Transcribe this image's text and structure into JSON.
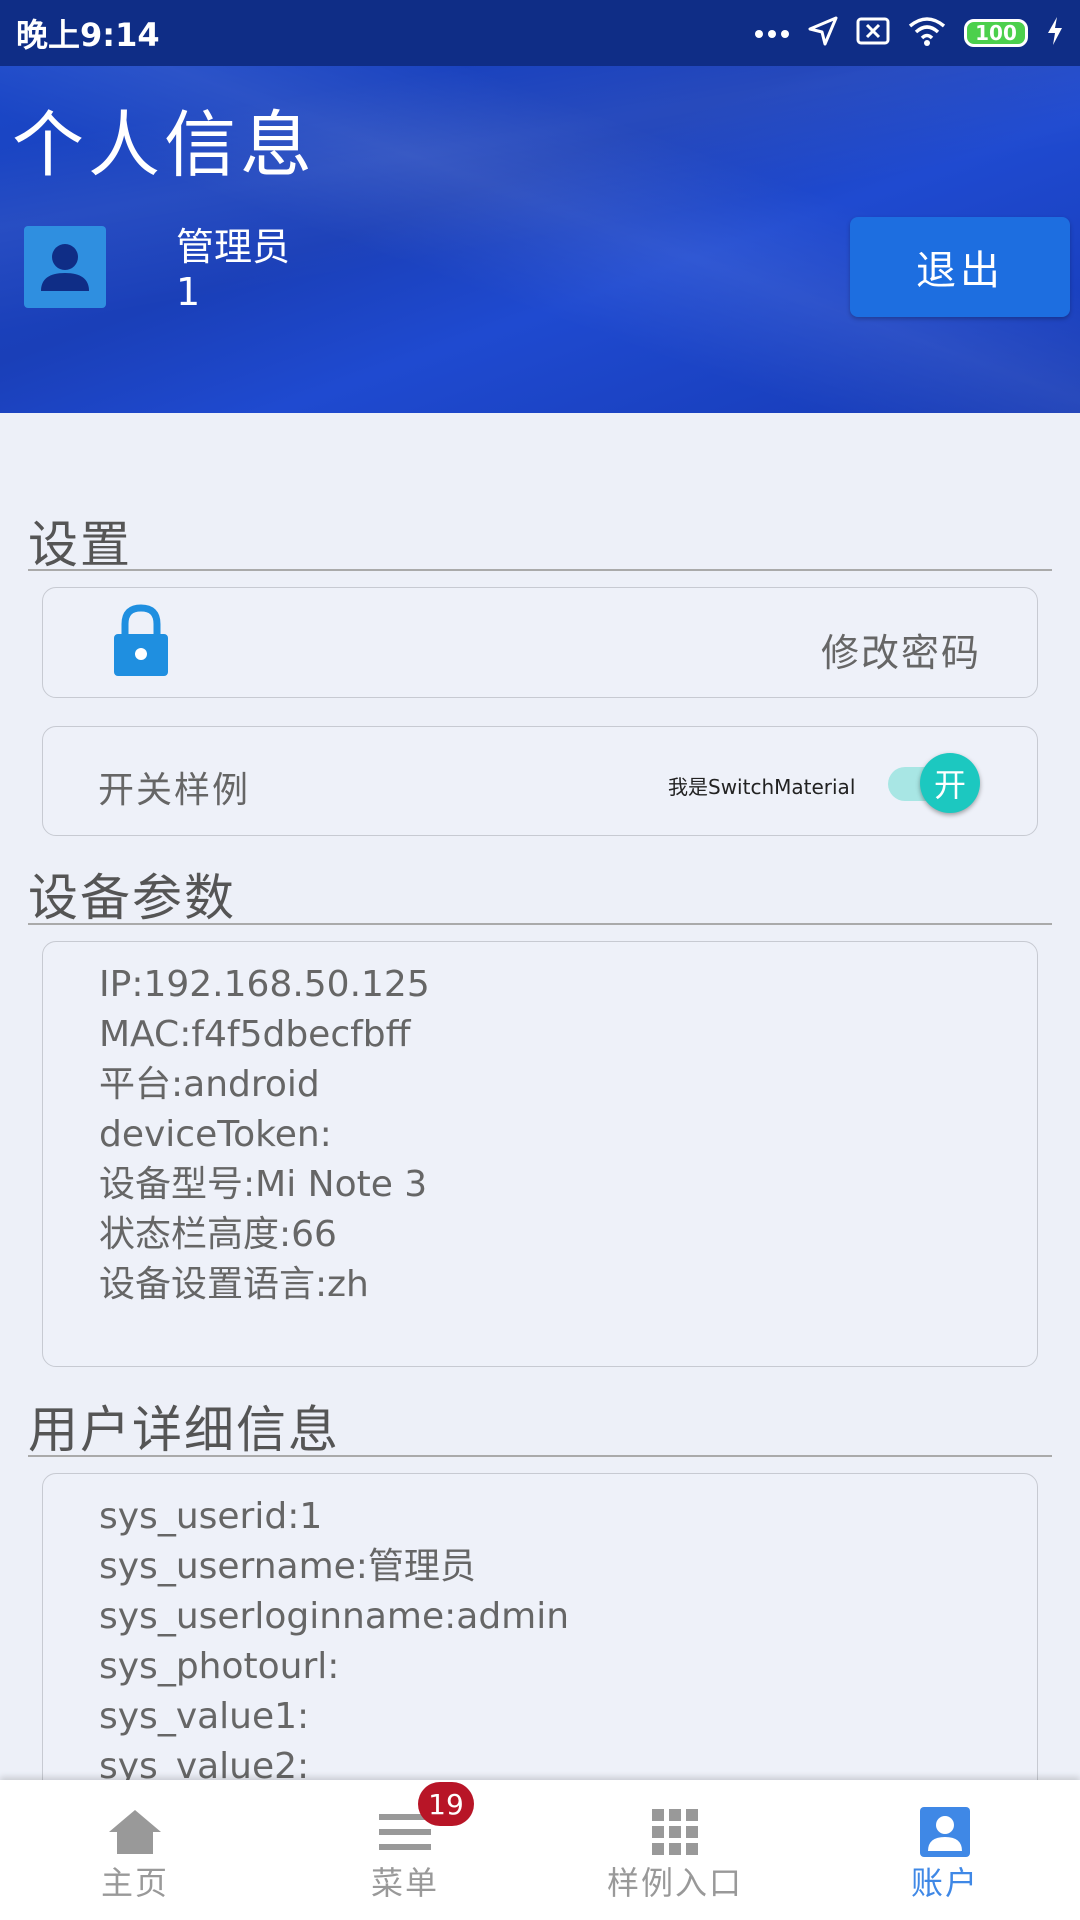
{
  "status_bar": {
    "time": "晚上9:14",
    "battery": "100"
  },
  "header": {
    "title": "个人信息",
    "user_name": "管理员",
    "user_id": "1",
    "logout_label": "退出"
  },
  "settings": {
    "section_title": "设置",
    "change_password_label": "修改密码",
    "switch_label": "开关样例",
    "switch_desc": "我是SwitchMaterial",
    "switch_state_text": "开",
    "switch_on": true
  },
  "device": {
    "section_title": "设备参数",
    "lines": [
      "IP:192.168.50.125",
      "MAC:f4f5dbecfbff",
      "平台:android",
      "deviceToken:",
      "设备型号:Mi Note 3",
      "状态栏高度:66",
      "设备设置语言:zh"
    ]
  },
  "user_detail": {
    "section_title": "用户详细信息",
    "lines": [
      "sys_userid:1",
      "sys_username:管理员",
      "sys_userloginname:admin",
      "sys_photourl:",
      "sys_value1:",
      "sys_value2:"
    ]
  },
  "bottom_nav": {
    "items": [
      {
        "label": "主页",
        "icon": "home-icon"
      },
      {
        "label": "菜单",
        "icon": "menu-icon",
        "badge": "19"
      },
      {
        "label": "样例入口",
        "icon": "grid-icon"
      },
      {
        "label": "账户",
        "icon": "account-icon"
      }
    ],
    "active_color": "#3f88e6"
  }
}
